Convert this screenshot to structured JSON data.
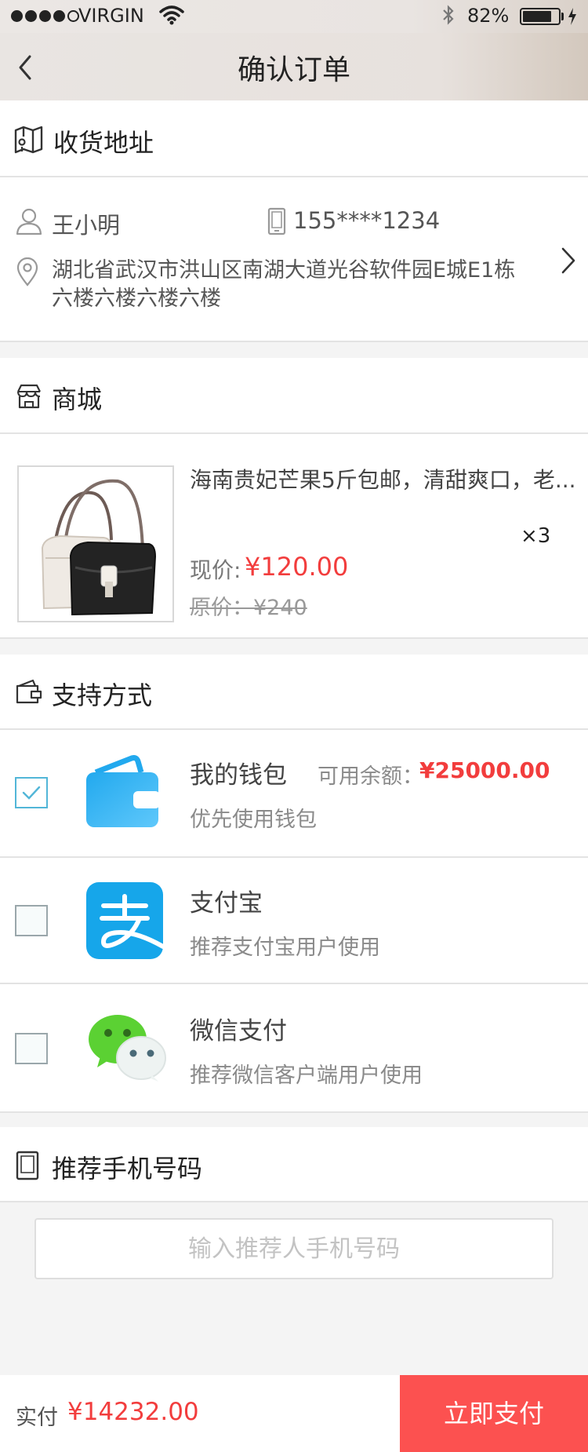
{
  "status_bar": {
    "carrier": "VIRGIN",
    "battery": "82%",
    "battery_level": 0.82
  },
  "nav": {
    "title": "确认订单"
  },
  "address": {
    "section_title": "收货地址",
    "name": "王小明",
    "phone": "155****1234",
    "line1": "湖北省武汉市洪山区南湖大道光谷软件园E城E1栋",
    "line2": "六楼六楼六楼六楼"
  },
  "shop": {
    "section_title": "商城",
    "product_name": "海南贵妃芒果5斤包邮，清甜爽口，老...",
    "quantity": "×3",
    "price_label": "现价:",
    "price": "¥120.00",
    "original_price": "原价：¥240"
  },
  "payment": {
    "section_title": "支持方式",
    "methods": [
      {
        "name": "我的钱包",
        "desc": "优先使用钱包",
        "balance_label": "可用余额：",
        "balance": "¥25000.00",
        "checked": true
      },
      {
        "name": "支付宝",
        "desc": "推荐支付宝用户使用",
        "checked": false
      },
      {
        "name": "微信支付",
        "desc": "推荐微信客户端用户使用",
        "checked": false
      }
    ]
  },
  "referrer": {
    "section_title": "推荐手机号码",
    "placeholder": "输入推荐人手机号码"
  },
  "footer": {
    "total_label": "实付",
    "total": "¥14232.00",
    "pay_button": "立即支付"
  },
  "colors": {
    "accent_red": "#f23d3d",
    "pay_button": "#fc5150",
    "blue": "#1aa5e8"
  }
}
